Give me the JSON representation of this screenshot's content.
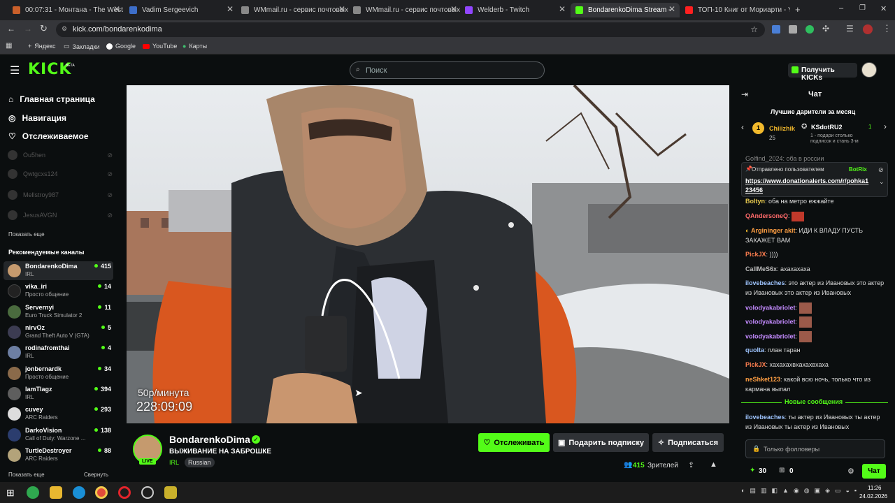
{
  "browser": {
    "tabs": [
      {
        "title": "00:07:31 - Монтана - The West",
        "color": "#c95f2a",
        "active": false
      },
      {
        "title": "Vadim Sergeevich",
        "color": "#3d6ec9",
        "active": false
      },
      {
        "title": "WMmail.ru - сервис почтовых",
        "color": "#888888",
        "active": false
      },
      {
        "title": "WMmail.ru - сервис почтовых",
        "color": "#888888",
        "active": false
      },
      {
        "title": "Welderb - Twitch",
        "color": "#9146ff",
        "active": false
      },
      {
        "title": "BondarenkoDima Stream -",
        "color": "#53fc18",
        "active": true
      },
      {
        "title": "ТОП-10 Книг от Мориарти - Y",
        "color": "#ff2020",
        "active": false
      }
    ],
    "url": "kick.com/bondarenkodima",
    "bookmarks": [
      "Яндекс",
      "Закладки",
      "Google",
      "YouTube",
      "Карты"
    ]
  },
  "header": {
    "logo": "KICK",
    "logo_beta": "BETA",
    "search_placeholder": "Поиск",
    "kicks_button": "Получить KICKs"
  },
  "sidebar": {
    "menu": [
      {
        "label": "Главная страница",
        "icon": "home-icon"
      },
      {
        "label": "Навигация",
        "icon": "compass-icon"
      },
      {
        "label": "Отслеживаемое",
        "icon": "heart-icon"
      }
    ],
    "followed_offline": [
      "Ou5hen",
      "Qwtgcxs124",
      "Mellstroy987",
      "JesusAVGN"
    ],
    "show_more": "Показать еще",
    "recommended_title": "Рекомендуемые каналы",
    "recommended": [
      {
        "name": "BondarenkoDima",
        "category": "IRL",
        "viewers": "415",
        "color": "#c59a6e",
        "active": true
      },
      {
        "name": "vika_iri",
        "category": "Просто общение",
        "viewers": "14",
        "color": "#222222",
        "active": false
      },
      {
        "name": "Servernyi",
        "category": "Euro Truck Simulator 2",
        "viewers": "11",
        "color": "#4a6b3e",
        "active": false
      },
      {
        "name": "nirvOz",
        "category": "Grand Theft Auto V (GTA)",
        "viewers": "5",
        "color": "#3c3c52",
        "active": false
      },
      {
        "name": "rodinafromthai",
        "category": "IRL",
        "viewers": "4",
        "color": "#6d7fa3",
        "active": false
      },
      {
        "name": "jonbernardk",
        "category": "Просто общение",
        "viewers": "34",
        "color": "#8a6a4a",
        "active": false
      },
      {
        "name": "lamTlagz",
        "category": "IRL",
        "viewers": "394",
        "color": "#5e5e5e",
        "active": false
      },
      {
        "name": "cuvey",
        "category": "ARC Raiders",
        "viewers": "293",
        "color": "#dddddd",
        "active": false
      },
      {
        "name": "DarkoVision",
        "category": "Call of Duty: Warzone ...",
        "viewers": "138",
        "color": "#2b3d6e",
        "active": false
      },
      {
        "name": "TurtleDestroyer",
        "category": "ARC Raiders",
        "viewers": "88",
        "color": "#b3a37a",
        "active": false
      }
    ],
    "footer_more": "Показать еще",
    "footer_collapse": "Свернуть"
  },
  "video": {
    "overlay_rate": "50р/минута",
    "overlay_time": "228:09:09"
  },
  "stream": {
    "streamer": "BondarenkoDima",
    "title": "ВЫЖИВАНИЕ НА ЗАБРОШКЕ",
    "category": "IRL",
    "language": "Russian",
    "live_badge": "LIVE",
    "follow_button": "Отслеживать",
    "gift_button": "Подарить подписку",
    "subscribe_button": "Подписаться",
    "viewers": "415",
    "viewers_label": "Зрителей"
  },
  "chat": {
    "title": "Чат",
    "leaders_title": "Лучшие дарители за месяц",
    "leader1_rank": "1",
    "leader1_name": "Chiiizhik",
    "leader1_count": "25",
    "leader2_name": "KSdotRU2",
    "leader2_count": "1",
    "leader2_sub": "1 - подари столько подписок и стань 3-м",
    "cut_message": "Golfind_2024: оба в россии",
    "pinned_by": "Отправлено пользователем",
    "pinned_user": "BotRix",
    "pinned_link": "https://www.donationalerts.com/r/pohka123456",
    "messages": [
      {
        "user": "Boltyn",
        "color": "#e6c94f",
        "text": "оба на метро ежжайте"
      },
      {
        "user": "QAndersoneQ",
        "color": "#ff6b6b",
        "text": ""
      },
      {
        "user": "Argininger akit",
        "color": "#ff9f43",
        "text": "ИДИ К ВЛАДУ ПУСТЬ ЗАКАЖЕТ ВАМ"
      },
      {
        "user": "PickJX",
        "color": "#ff7f50",
        "text": "))))"
      },
      {
        "user": "CallMeS6x",
        "color": "#bbbbbb",
        "text": "ахахахаха"
      },
      {
        "user": "ilovebeaches",
        "color": "#9fc5ff",
        "text": "это актер из Ивановых это актер из Ивановых это актер из Ивановых"
      },
      {
        "user": "volodyakabriolet",
        "color": "#c48bff",
        "text": ""
      },
      {
        "user": "volodyakabriolet",
        "color": "#c48bff",
        "text": ""
      },
      {
        "user": "volodyakabriolet",
        "color": "#c48bff",
        "text": ""
      },
      {
        "user": "quolta",
        "color": "#9fc5ff",
        "text": "план таран"
      },
      {
        "user": "PickJX",
        "color": "#ff7f50",
        "text": "хахахахвхахахвхаха"
      },
      {
        "user": "neShket123",
        "color": "#ff9f43",
        "text": "какой всю ночь, только что из кармана выпал"
      }
    ],
    "new_messages_label": "Новые сообщения",
    "last_message": {
      "user": "ilovebeaches",
      "color": "#9fc5ff",
      "text": "ты актер из Ивановых ты актер из Ивановых ты актер из Ивановых"
    },
    "input_placeholder": "Только фолловеры",
    "points": "30",
    "gifts": "0",
    "send_button": "Чат"
  },
  "taskbar": {
    "time": "11:26",
    "date": "24.02.2026"
  },
  "colors": {
    "brand": "#53fc18",
    "background": "#0b0e0f"
  }
}
